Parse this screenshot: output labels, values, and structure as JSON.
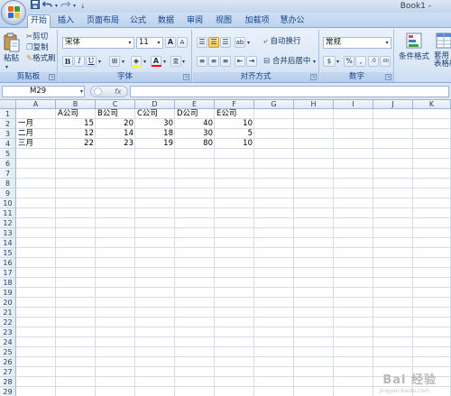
{
  "window": {
    "title": "Book1 - "
  },
  "qat": {
    "save_icon": "save-icon",
    "undo_icon": "undo-icon",
    "redo_icon": "redo-icon"
  },
  "tabs": [
    "开始",
    "插入",
    "页面布局",
    "公式",
    "数据",
    "审阅",
    "视图",
    "加载项",
    "慧办公"
  ],
  "ribbon": {
    "clipboard": {
      "label": "剪贴板",
      "paste": "粘贴",
      "cut": "剪切",
      "copy": "复制",
      "format_painter": "格式刷"
    },
    "font": {
      "label": "字体",
      "font_name": "宋体",
      "font_size": "11",
      "bold": "B",
      "italic": "I",
      "underline": "U",
      "grow": "A",
      "shrink": "A",
      "font_color_glyph": "A",
      "phonetic": "变"
    },
    "alignment": {
      "label": "对齐方式",
      "wrap": "自动换行",
      "merge": "合并后居中"
    },
    "number": {
      "label": "数字",
      "format": "常规",
      "currency": "$",
      "percent": "%",
      "comma": ",",
      "inc": ".0",
      "dec": ".00"
    },
    "styles": {
      "conditional": "条件格式",
      "table_format": "套用\n表格格式"
    }
  },
  "formula_bar": {
    "name_box": "M29",
    "fx": "fx",
    "formula": ""
  },
  "columns": [
    "A",
    "B",
    "C",
    "D",
    "E",
    "F",
    "G",
    "H",
    "I",
    "J",
    "K"
  ],
  "rows": [
    "1",
    "2",
    "3",
    "4",
    "5",
    "6",
    "7",
    "8",
    "9",
    "10",
    "11",
    "12",
    "13",
    "14",
    "15",
    "16",
    "17",
    "18",
    "19",
    "20",
    "21",
    "22",
    "23",
    "24",
    "25",
    "26",
    "27",
    "28",
    "29"
  ],
  "sheet": {
    "headers": [
      "",
      "A公司",
      "B公司",
      "C公司",
      "D公司",
      "E公司"
    ],
    "data": [
      {
        "label": "一月",
        "values": [
          "15",
          "20",
          "30",
          "40",
          "10"
        ]
      },
      {
        "label": "二月",
        "values": [
          "12",
          "14",
          "18",
          "30",
          "5"
        ]
      },
      {
        "label": "三月",
        "values": [
          "22",
          "23",
          "19",
          "80",
          "10"
        ]
      }
    ]
  },
  "watermark": {
    "text": "Bai 经验",
    "sub": "jingyan.baidu.com"
  },
  "colors": {
    "ribbon_bg": "#dbe7f6",
    "tab_text": "#15428b",
    "grid_line": "#d4dce8",
    "header_bg": "#e2eaf4"
  }
}
